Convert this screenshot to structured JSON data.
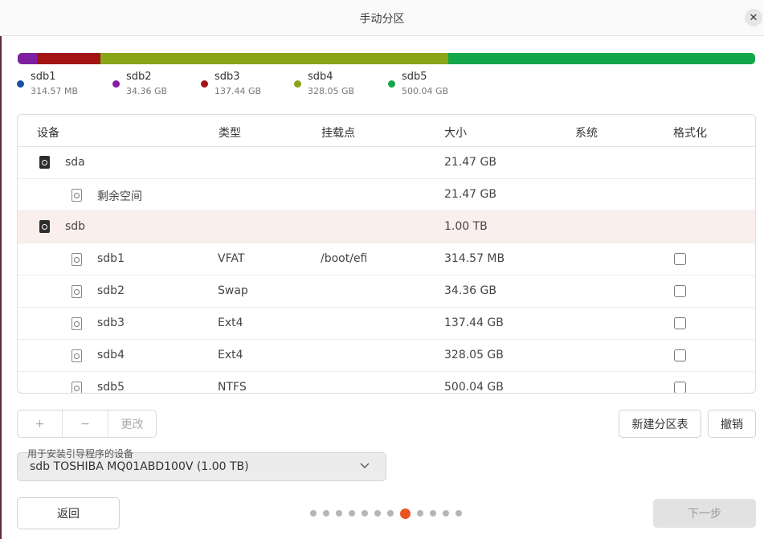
{
  "window": {
    "title": "手动分区",
    "close_symbol": "✕"
  },
  "usage_bar": [
    {
      "name": "sdb1",
      "size_tb": 0.31457,
      "color": "#7d1fa0"
    },
    {
      "name": "sdb2",
      "size_tb": 1.03436,
      "color": "#a31515"
    },
    {
      "name": "sdb3",
      "size_tb": 2.37744,
      "color": "#8aa51a"
    },
    {
      "name": "sdb4",
      "size_tb": 3.28805,
      "color": "#8aa51a"
    },
    {
      "name": "sdb5",
      "size_tb": 5.00004,
      "color": "#14a64a"
    }
  ],
  "legend": [
    {
      "name": "sdb1",
      "size": "314.57 MB",
      "color": "#1a4fa8"
    },
    {
      "name": "sdb2",
      "size": "34.36 GB",
      "color": "#8a1ba8"
    },
    {
      "name": "sdb3",
      "size": "137.44 GB",
      "color": "#a31515"
    },
    {
      "name": "sdb4",
      "size": "328.05 GB",
      "color": "#8aa51a"
    },
    {
      "name": "sdb5",
      "size": "500.04 GB",
      "color": "#14a64a"
    }
  ],
  "table": {
    "headers": {
      "device": "设备",
      "type": "类型",
      "mount": "挂载点",
      "size": "大小",
      "system": "系统",
      "format": "格式化"
    },
    "rows": [
      {
        "kind": "disk",
        "device": "sda",
        "type": "",
        "mount": "",
        "size": "21.47 GB",
        "selected": false,
        "checkbox": false
      },
      {
        "kind": "part",
        "device": "剩余空间",
        "type": "",
        "mount": "",
        "size": "21.47 GB",
        "selected": false,
        "checkbox": false
      },
      {
        "kind": "disk",
        "device": "sdb",
        "type": "",
        "mount": "",
        "size": "1.00 TB",
        "selected": true,
        "checkbox": false
      },
      {
        "kind": "part",
        "device": "sdb1",
        "type": "VFAT",
        "mount": "/boot/efi",
        "size": "314.57 MB",
        "selected": false,
        "checkbox": true
      },
      {
        "kind": "part",
        "device": "sdb2",
        "type": "Swap",
        "mount": "",
        "size": "34.36 GB",
        "selected": false,
        "checkbox": true
      },
      {
        "kind": "part",
        "device": "sdb3",
        "type": "Ext4",
        "mount": "",
        "size": "137.44 GB",
        "selected": false,
        "checkbox": true
      },
      {
        "kind": "part",
        "device": "sdb4",
        "type": "Ext4",
        "mount": "",
        "size": "328.05 GB",
        "selected": false,
        "checkbox": true
      },
      {
        "kind": "part",
        "device": "sdb5",
        "type": "NTFS",
        "mount": "",
        "size": "500.04 GB",
        "selected": false,
        "checkbox": true
      }
    ]
  },
  "toolbar": {
    "add": "+",
    "remove": "−",
    "change": "更改",
    "new_table": "新建分区表",
    "revert": "撤销"
  },
  "boot_device": {
    "label": "用于安装引导程序的设备",
    "value": "sdb TOSHIBA MQ01ABD100V (1.00 TB)"
  },
  "footer": {
    "back": "返回",
    "next": "下一步"
  },
  "pager": {
    "total": 12,
    "current": 8
  },
  "colors": {
    "accent": "#e95420",
    "selected_row": "#fbefed"
  }
}
